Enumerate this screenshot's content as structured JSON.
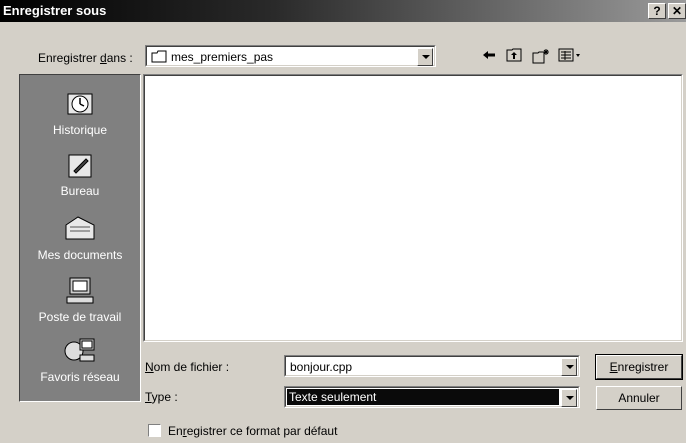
{
  "window": {
    "title": "Enregistrer sous",
    "help_glyph": "?",
    "close_glyph": "✕"
  },
  "save_in": {
    "label_pre": "Enregistrer ",
    "label_u": "d",
    "label_post": "ans :",
    "folder": "mes_premiers_pas",
    "folder_icon": "folder-icon"
  },
  "toolbar": {
    "back_icon": "back-arrow-icon",
    "up_icon": "up-folder-icon",
    "new_folder_icon": "new-folder-icon",
    "view_icon": "view-menu-icon"
  },
  "places": [
    {
      "label": "Historique",
      "icon": "history-icon"
    },
    {
      "label": "Bureau",
      "icon": "desktop-icon"
    },
    {
      "label": "Mes documents",
      "icon": "my-documents-icon"
    },
    {
      "label": "Poste de travail",
      "icon": "my-computer-icon"
    },
    {
      "label": "Favoris réseau",
      "icon": "network-places-icon"
    }
  ],
  "filename": {
    "label_u": "N",
    "label_post": "om de fichier :",
    "value": "bonjour.cpp"
  },
  "filetype": {
    "label_u": "T",
    "label_post": "ype :",
    "value": "Texte seulement"
  },
  "buttons": {
    "save_u": "E",
    "save_post": "nregistrer",
    "cancel": "Annuler"
  },
  "default_format": {
    "pre": "En",
    "u": "r",
    "post": "egistrer ce format par défaut",
    "checked": false
  }
}
